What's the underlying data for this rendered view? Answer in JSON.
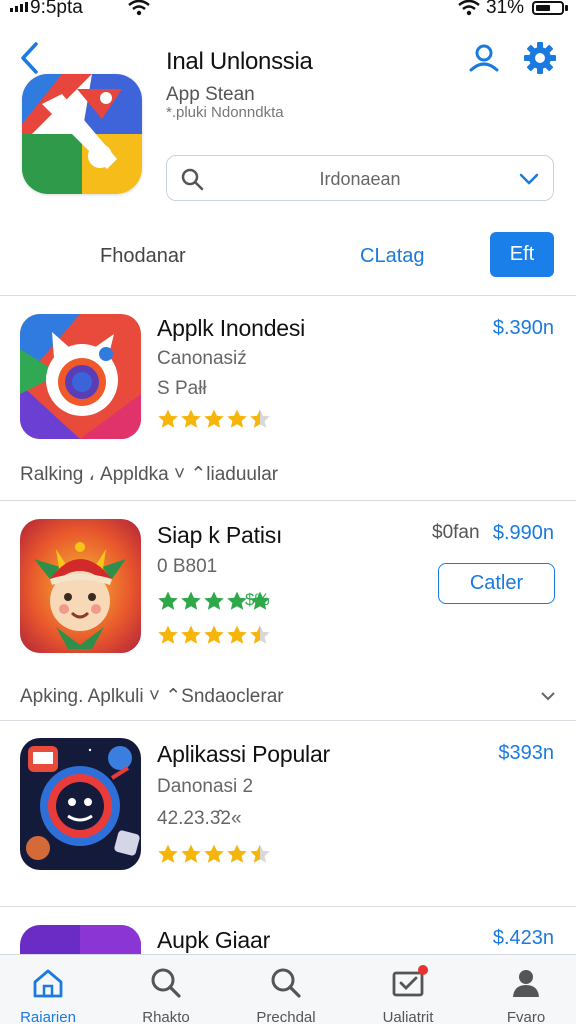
{
  "status_bar": {
    "time": "9:5pta",
    "battery": "31%"
  },
  "header": {
    "title": "Inal Unlonssia",
    "subtitle": "App Stean",
    "subtitle2": "*.pluki Ndonndkta",
    "region_select": {
      "value": "Irdonaean"
    },
    "filter_label": "Fhodanar",
    "catalog_link": "CLatag",
    "edit_button": "Eft"
  },
  "apps": [
    {
      "name": "Applk Inondesi",
      "developer": "Canonasiź",
      "meta": "S Pałł",
      "price": "$.390n",
      "rating": 4.5
    },
    {
      "name": "Siap k Patisı",
      "meta": "0 B801",
      "price_old": "$0fan",
      "price": "$.990n",
      "rating_text": "$%",
      "rating": 5,
      "rating2": 4.5,
      "button": "Catler"
    },
    {
      "name": "Aplikassi Popular",
      "developer": "Danonasi 2",
      "meta": "42.23.3̂2«",
      "price": "$393n",
      "rating": 4.5
    },
    {
      "name": "Aupk Giaar",
      "price": "$.423n"
    }
  ],
  "sections": [
    {
      "label": "Ralking ، Appldka ˅ ⌃liaduular"
    },
    {
      "label": "Apking. Aplkuli ˅ ⌃Sndaoclerar"
    }
  ],
  "tabs": [
    {
      "label": "Raiarien",
      "icon": "home-icon",
      "active": true
    },
    {
      "label": "Rhakto",
      "icon": "search-icon"
    },
    {
      "label": "Prechdal",
      "icon": "search-icon"
    },
    {
      "label": "Ualiatrit",
      "icon": "mail-icon"
    },
    {
      "label": "Fvaro",
      "icon": "person-icon"
    }
  ],
  "colors": {
    "accent": "#1a7ae0",
    "star": "#f5b50a",
    "badge": "#e8322d"
  }
}
